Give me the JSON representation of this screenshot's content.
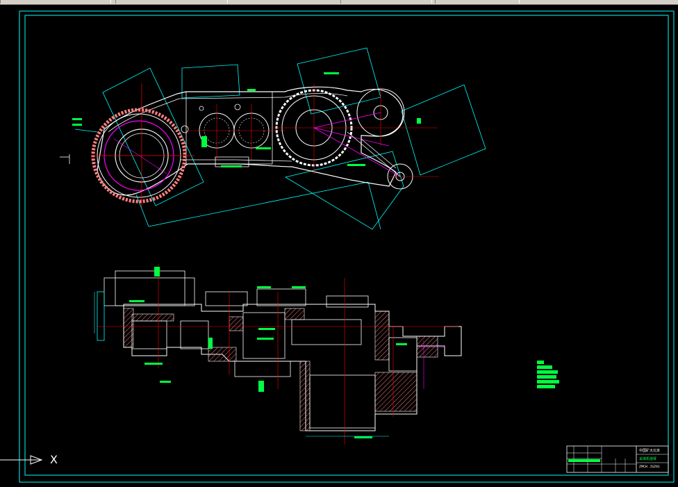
{
  "window": {
    "toolbar_present": true
  },
  "drawing": {
    "background": "#000000",
    "colors": {
      "border": "#00ffff",
      "geometry": "#ffffff",
      "centerlines": "#ff0000",
      "dimensions": "#00ff40",
      "hatch": "#ff8080",
      "path": "#ff00ff",
      "ucs": "#ffffff"
    },
    "ucs_axis_label": "X"
  },
  "title_block": {
    "line_1": "中国矿大北京",
    "line_2": "采煤机摇臂",
    "line_3": "ZMCH JSZ01"
  }
}
